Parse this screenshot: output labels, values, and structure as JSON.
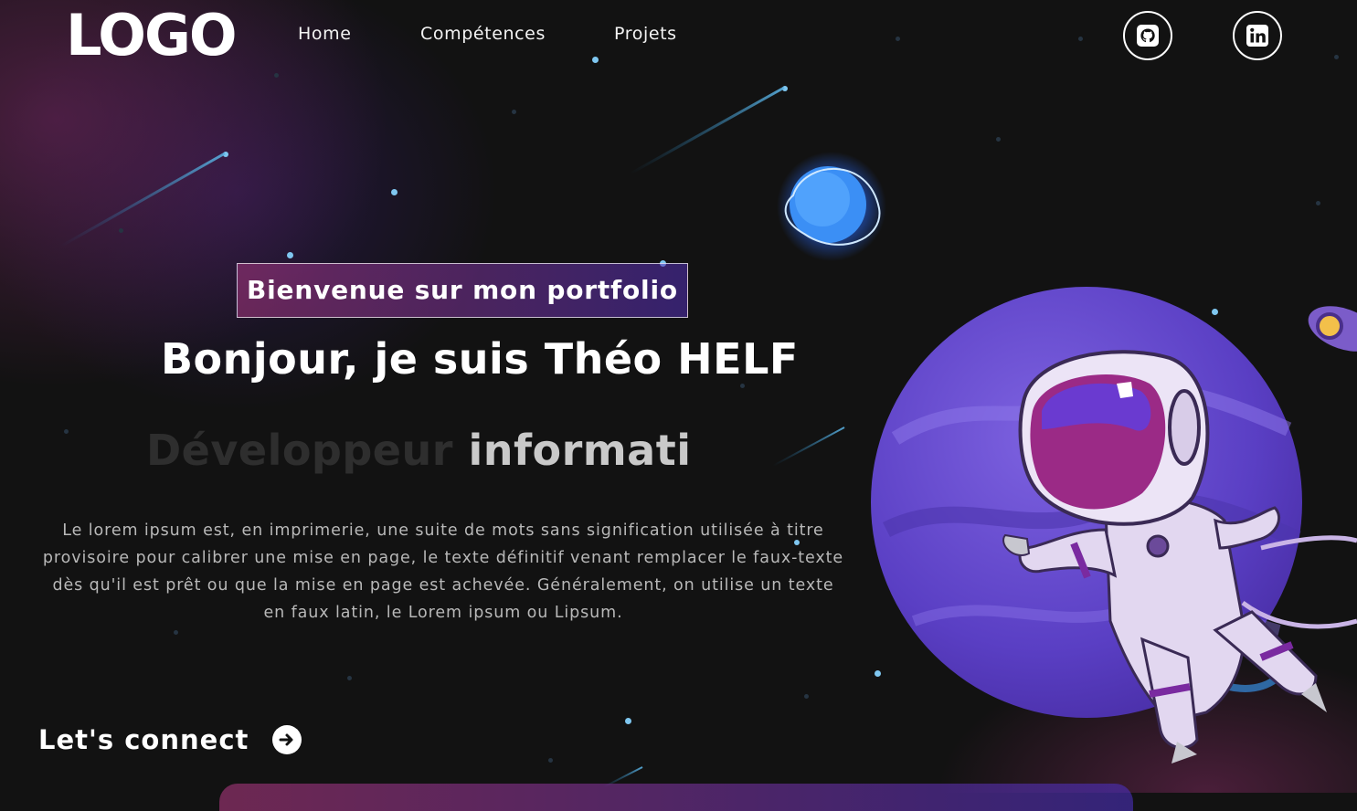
{
  "nav": {
    "logo": "LOGO",
    "links": [
      "Home",
      "Compétences",
      "Projets"
    ],
    "social": [
      {
        "icon": "github-icon"
      },
      {
        "icon": "linkedin-icon"
      }
    ]
  },
  "banner": {
    "tagline": "Bienvenue sur mon portfolio",
    "headline": "Bonjour, je suis Théo HELF",
    "typing_faded": "Développeur ",
    "typing_visible": "informati",
    "intro": "Le lorem ipsum est, en imprimerie, une suite de mots sans signification utilisée à titre provisoire pour calibrer une mise en page, le texte définitif venant remplacer le faux-texte dès qu'il est prêt ou que la mise en page est achevée. Généralement, on utilise un texte en faux latin, le Lorem ipsum ou Lipsum.",
    "cta": "Let's connect",
    "cta_icon": "arrow-right-circle-icon"
  },
  "colors": {
    "background": "#121212",
    "gradient_start": "#aa367c",
    "gradient_end": "#4a2fbd",
    "planet": "#6a4fd0",
    "star": "#7fc7f0"
  }
}
